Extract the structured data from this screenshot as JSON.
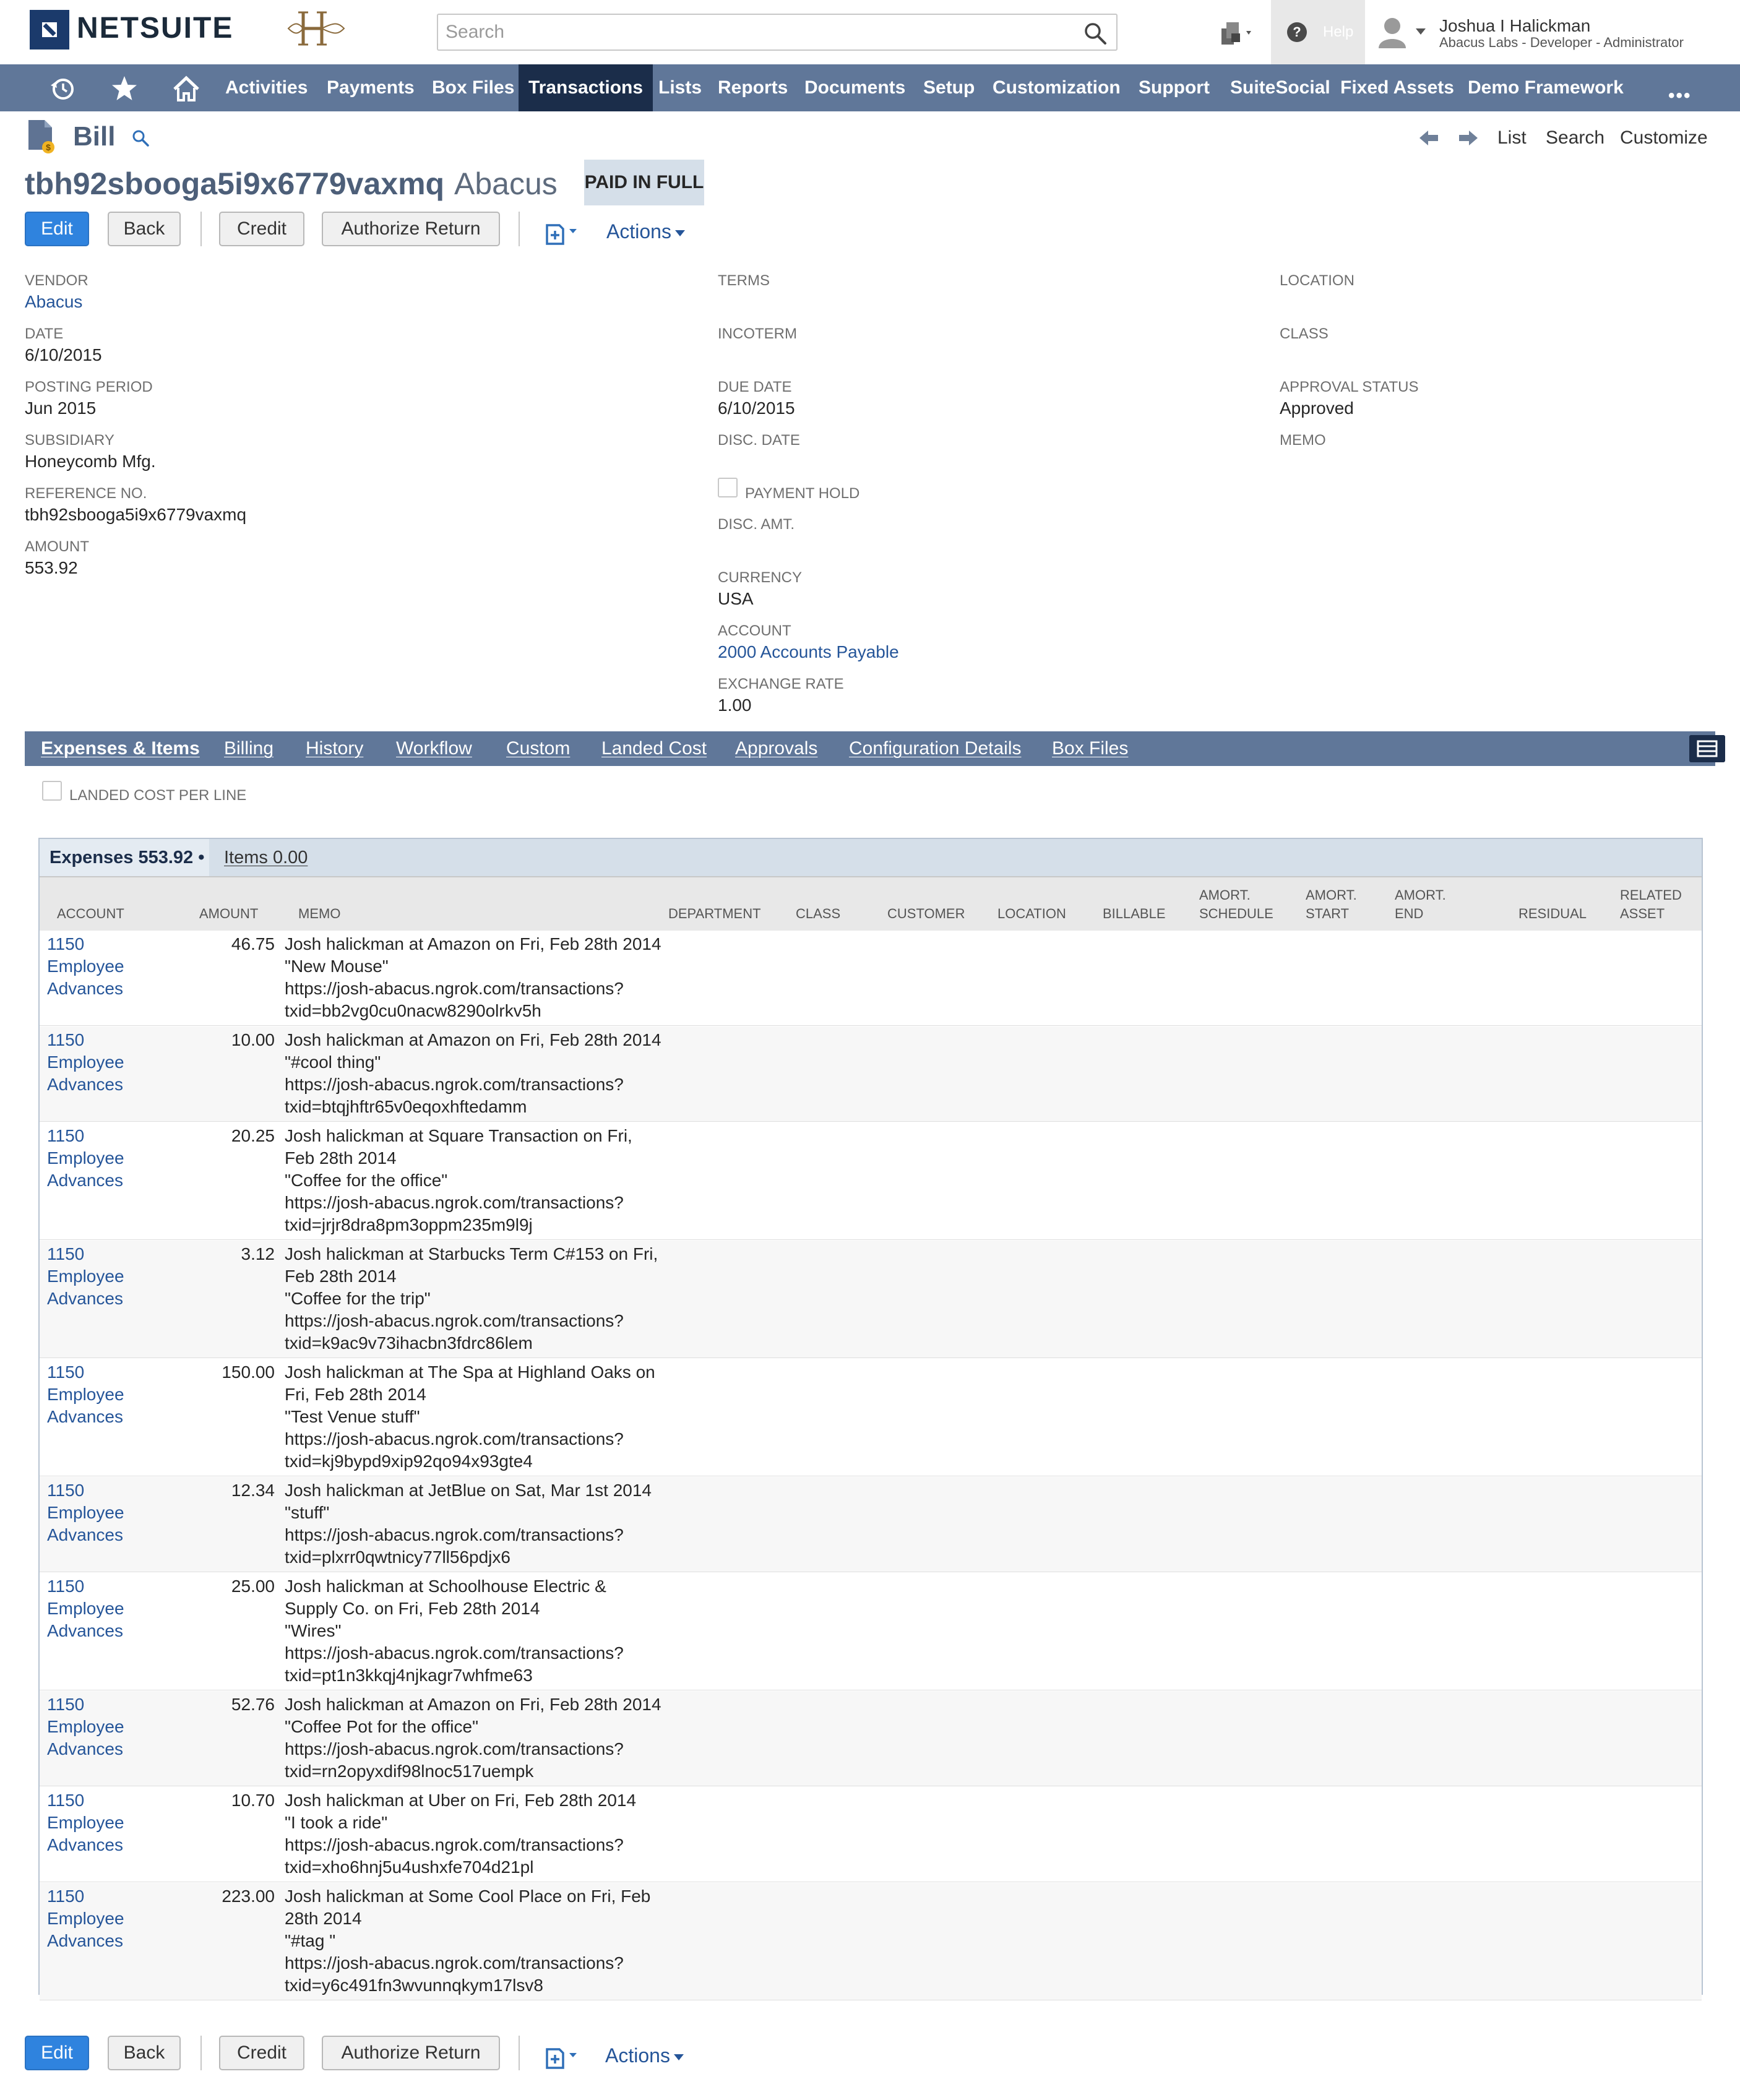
{
  "header": {
    "logo_text": "NETSUITE",
    "search_placeholder": "Search",
    "help_label": "Help",
    "user_name": "Joshua I Halickman",
    "user_role": "Abacus Labs - Developer - Administrator"
  },
  "nav": {
    "items": [
      {
        "label": "Activities"
      },
      {
        "label": "Payments"
      },
      {
        "label": "Box Files"
      },
      {
        "label": "Transactions",
        "active": true
      },
      {
        "label": "Lists"
      },
      {
        "label": "Reports"
      },
      {
        "label": "Documents"
      },
      {
        "label": "Setup"
      },
      {
        "label": "Customization"
      },
      {
        "label": "Support"
      },
      {
        "label": "SuiteSocial"
      },
      {
        "label": "Fixed Assets"
      },
      {
        "label": "Demo Framework"
      }
    ],
    "more": "•••"
  },
  "record": {
    "type": "Bill",
    "number": "tbh92sbooga5i9x6779vaxmq",
    "vendor": "Abacus",
    "status": "PAID IN FULL",
    "nav_links": {
      "list": "List",
      "search": "Search",
      "customize": "Customize"
    }
  },
  "buttons": {
    "edit": "Edit",
    "back": "Back",
    "credit": "Credit",
    "authorize_return": "Authorize Return",
    "actions": "Actions"
  },
  "fields": {
    "vendor": {
      "label": "VENDOR",
      "value": "Abacus"
    },
    "date": {
      "label": "DATE",
      "value": "6/10/2015"
    },
    "posting_period": {
      "label": "POSTING PERIOD",
      "value": "Jun 2015"
    },
    "subsidiary": {
      "label": "SUBSIDIARY",
      "value": "Honeycomb Mfg."
    },
    "reference_no": {
      "label": "REFERENCE NO.",
      "value": "tbh92sbooga5i9x6779vaxmq"
    },
    "amount": {
      "label": "AMOUNT",
      "value": "553.92"
    },
    "terms": {
      "label": "TERMS",
      "value": ""
    },
    "incoterm": {
      "label": "INCOTERM",
      "value": ""
    },
    "due_date": {
      "label": "DUE DATE",
      "value": "6/10/2015"
    },
    "disc_date": {
      "label": "DISC. DATE",
      "value": ""
    },
    "payment_hold": {
      "label": "PAYMENT HOLD",
      "checked": false
    },
    "disc_amt": {
      "label": "DISC. AMT.",
      "value": ""
    },
    "currency": {
      "label": "CURRENCY",
      "value": "USA"
    },
    "account": {
      "label": "ACCOUNT",
      "value": "2000 Accounts Payable"
    },
    "exchange_rate": {
      "label": "EXCHANGE RATE",
      "value": "1.00"
    },
    "location": {
      "label": "LOCATION",
      "value": ""
    },
    "class": {
      "label": "CLASS",
      "value": ""
    },
    "approval_status": {
      "label": "APPROVAL STATUS",
      "value": "Approved"
    },
    "memo": {
      "label": "MEMO",
      "value": ""
    }
  },
  "subtabs": [
    {
      "label": "Expenses & Items",
      "active": true
    },
    {
      "label": "Billing"
    },
    {
      "label": "History"
    },
    {
      "label": "Workflow"
    },
    {
      "label": "Custom"
    },
    {
      "label": "Landed Cost"
    },
    {
      "label": "Approvals"
    },
    {
      "label": "Configuration Details"
    },
    {
      "label": "Box Files"
    }
  ],
  "landed_cost_per_line": {
    "label": "LANDED COST PER LINE",
    "checked": false
  },
  "sublist": {
    "expenses_tab": "Expenses 553.92 •",
    "items_tab": "Items 0.00",
    "columns": [
      "ACCOUNT",
      "AMOUNT",
      "MEMO",
      "DEPARTMENT",
      "CLASS",
      "CUSTOMER",
      "LOCATION",
      "BILLABLE",
      "AMORT.\nSCHEDULE",
      "AMORT.\nSTART",
      "AMORT.\nEND",
      "RESIDUAL",
      "RELATED\nASSET"
    ],
    "rows": [
      {
        "account": "1150\nEmployee\nAdvances",
        "amount": "46.75",
        "memo": "Josh halickman at Amazon on Fri, Feb 28th 2014\n\"New Mouse\"\nhttps://josh-abacus.ngrok.com/transactions?\ntxid=bb2vg0cu0nacw8290olrkv5h"
      },
      {
        "account": "1150\nEmployee\nAdvances",
        "amount": "10.00",
        "memo": "Josh halickman at Amazon on Fri, Feb 28th 2014\n\"#cool thing\"\nhttps://josh-abacus.ngrok.com/transactions?\ntxid=btqjhftr65v0eqoxhftedamm"
      },
      {
        "account": "1150\nEmployee\nAdvances",
        "amount": "20.25",
        "memo": "Josh halickman at Square Transaction on Fri,\nFeb 28th 2014\n\"Coffee for the office\"\nhttps://josh-abacus.ngrok.com/transactions?\ntxid=jrjr8dra8pm3oppm235m9l9j"
      },
      {
        "account": "1150\nEmployee\nAdvances",
        "amount": "3.12",
        "memo": "Josh halickman at Starbucks Term C#153 on Fri,\nFeb 28th 2014\n\"Coffee for the trip\"\nhttps://josh-abacus.ngrok.com/transactions?\ntxid=k9ac9v73ihacbn3fdrc86lem"
      },
      {
        "account": "1150\nEmployee\nAdvances",
        "amount": "150.00",
        "memo": "Josh halickman at The Spa at Highland Oaks on\nFri, Feb 28th 2014\n\"Test Venue stuff\"\nhttps://josh-abacus.ngrok.com/transactions?\ntxid=kj9bypd9xip92qo94x93gte4"
      },
      {
        "account": "1150\nEmployee\nAdvances",
        "amount": "12.34",
        "memo": "Josh halickman at JetBlue on Sat, Mar 1st 2014\n\"stuff\"\nhttps://josh-abacus.ngrok.com/transactions?\ntxid=plxrr0qwtnicy77ll56pdjx6"
      },
      {
        "account": "1150\nEmployee\nAdvances",
        "amount": "25.00",
        "memo": "Josh halickman at Schoolhouse Electric &\nSupply Co. on Fri, Feb 28th 2014\n\"Wires\"\nhttps://josh-abacus.ngrok.com/transactions?\ntxid=pt1n3kkqj4njkagr7whfme63"
      },
      {
        "account": "1150\nEmployee\nAdvances",
        "amount": "52.76",
        "memo": "Josh halickman at Amazon on Fri, Feb 28th 2014\n\"Coffee Pot for the office\"\nhttps://josh-abacus.ngrok.com/transactions?\ntxid=rn2opyxdif98lnoc517uempk"
      },
      {
        "account": "1150\nEmployee\nAdvances",
        "amount": "10.70",
        "memo": "Josh halickman at Uber on Fri, Feb 28th 2014\n\"I took a ride\"\nhttps://josh-abacus.ngrok.com/transactions?\ntxid=xho6hnj5u4ushxfe704d21pl"
      },
      {
        "account": "1150\nEmployee\nAdvances",
        "amount": "223.00",
        "memo": "Josh halickman at Some Cool Place on Fri, Feb\n28th 2014\n\"#tag \"\nhttps://josh-abacus.ngrok.com/transactions?\ntxid=y6c491fn3wvunnqkym17lsv8"
      }
    ]
  }
}
